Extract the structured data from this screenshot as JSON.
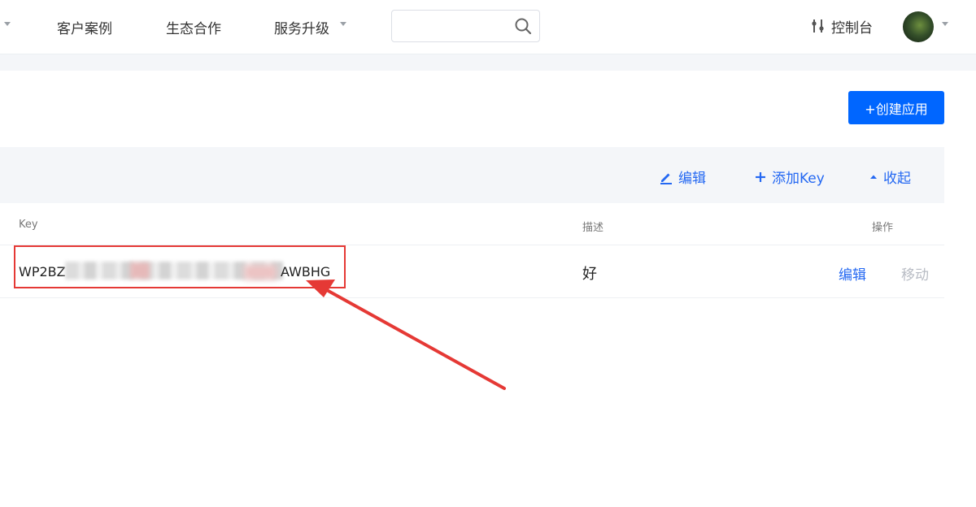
{
  "nav": {
    "items": [
      {
        "label": "客户案例"
      },
      {
        "label": "生态合作"
      },
      {
        "label": "服务升级"
      }
    ],
    "search": {
      "value": "",
      "placeholder": ""
    },
    "console_label": "控制台"
  },
  "actions": {
    "create_label": "+创建应用",
    "edit_label": "编辑",
    "add_key_label": "添加Key",
    "collapse_label": "收起"
  },
  "table": {
    "headers": {
      "key": "Key",
      "desc": "描述",
      "ops": "操作"
    },
    "rows": [
      {
        "key_prefix": "WP2BZ",
        "key_suffix": "AWBHG",
        "desc": "好",
        "edit": "编辑",
        "move": "移动"
      }
    ]
  },
  "colors": {
    "primary": "#0066ff",
    "link": "#2468f2",
    "annotation": "#e53935",
    "disabled": "#b8bcc4"
  }
}
